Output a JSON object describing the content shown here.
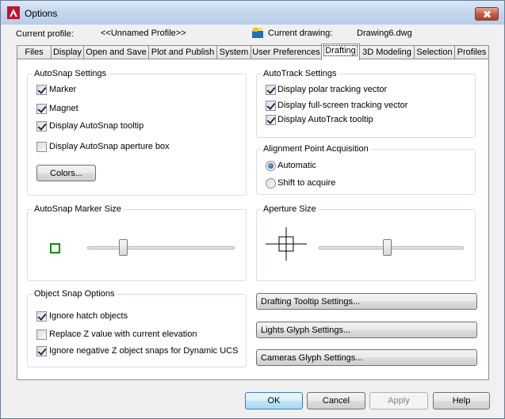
{
  "window": {
    "title": "Options"
  },
  "header": {
    "current_profile_label": "Current profile:",
    "current_profile_value": "<<Unnamed Profile>>",
    "current_drawing_label": "Current drawing:",
    "current_drawing_value": "Drawing6.dwg"
  },
  "tabs": [
    {
      "label": "Files"
    },
    {
      "label": "Display"
    },
    {
      "label": "Open and Save"
    },
    {
      "label": "Plot and Publish"
    },
    {
      "label": "System"
    },
    {
      "label": "User Preferences"
    },
    {
      "label": "Drafting",
      "active": true
    },
    {
      "label": "3D Modeling"
    },
    {
      "label": "Selection"
    },
    {
      "label": "Profiles"
    }
  ],
  "autosnap": {
    "title": "AutoSnap Settings",
    "marker": {
      "label": "Marker",
      "checked": true
    },
    "magnet": {
      "label": "Magnet",
      "checked": true
    },
    "tooltip": {
      "label": "Display AutoSnap tooltip",
      "checked": true
    },
    "aperture_box": {
      "label": "Display AutoSnap aperture box",
      "checked": false
    },
    "colors_button": "Colors..."
  },
  "autotrack": {
    "title": "AutoTrack Settings",
    "polar": {
      "label": "Display polar tracking vector",
      "checked": true
    },
    "fullscreen": {
      "label": "Display full-screen tracking vector",
      "checked": true
    },
    "tooltip": {
      "label": "Display AutoTrack tooltip",
      "checked": true
    }
  },
  "alignment": {
    "title": "Alignment Point Acquisition",
    "automatic": {
      "label": "Automatic",
      "selected": true
    },
    "shift": {
      "label": "Shift to acquire",
      "selected": false
    }
  },
  "marker_size": {
    "title": "AutoSnap Marker Size",
    "marker_color": "#0a8c0a",
    "value_fraction": 0.23
  },
  "aperture_size": {
    "title": "Aperture Size",
    "value_fraction": 0.47
  },
  "object_snap": {
    "title": "Object Snap Options",
    "ignore_hatch": {
      "label": "Ignore hatch objects",
      "checked": true
    },
    "replace_z": {
      "label": "Replace Z value with current elevation",
      "checked": false
    },
    "ignore_negative_z": {
      "label": "Ignore negative Z object snaps for Dynamic UCS",
      "checked": true
    }
  },
  "side_buttons": {
    "tooltip_settings": "Drafting Tooltip Settings...",
    "lights_glyph": "Lights Glyph Settings...",
    "cameras_glyph": "Cameras Glyph Settings..."
  },
  "footer": {
    "ok": "OK",
    "cancel": "Cancel",
    "apply": "Apply",
    "help": "Help"
  },
  "colors": {
    "title_gradient": "#c4d7ee",
    "accent": "#3c7fb1",
    "close_red": "#c7563c"
  }
}
